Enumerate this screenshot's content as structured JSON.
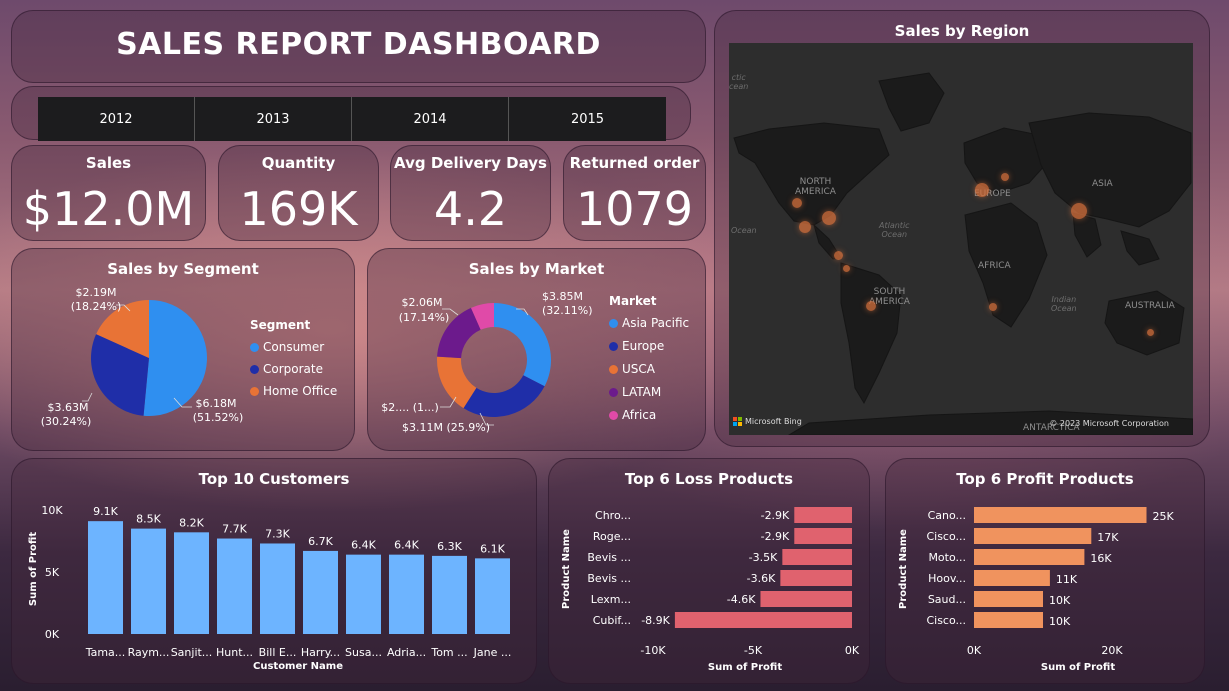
{
  "header": {
    "title": "SALES REPORT DASHBOARD"
  },
  "years": [
    "2012",
    "2013",
    "2014",
    "2015"
  ],
  "kpis": {
    "sales": {
      "label": "Sales",
      "value": "$12.0M"
    },
    "quantity": {
      "label": "Quantity",
      "value": "169K"
    },
    "delivery": {
      "label": "Avg Delivery Days",
      "value": "4.2"
    },
    "returned": {
      "label": "Returned order",
      "value": "1079"
    }
  },
  "region": {
    "title": "Sales by Region",
    "labels": {
      "north_america": "NORTH\nAMERICA",
      "europe": "EUROPE",
      "asia": "ASIA",
      "africa": "AFRICA",
      "south_america": "SOUTH\nAMERICA",
      "australia": "AUSTRALIA",
      "antarctica": "ANTARCTICA",
      "atlantic": "Atlantic\nOcean",
      "indian": "Indian\nOcean",
      "pacific": "Ocean",
      "arctic": "ctic\ncean"
    },
    "bing": "Microsoft Bing",
    "copyright": "© 2023 Microsoft Corporation"
  },
  "segment": {
    "title": "Sales by Segment",
    "legend_title": "Segment",
    "slices": [
      {
        "name": "Consumer",
        "value": 6.18,
        "label": "$6.18M",
        "pct": "(51.52%)",
        "color": "#2f8ff0"
      },
      {
        "name": "Corporate",
        "value": 3.63,
        "label": "$3.63M",
        "pct": "(30.24%)",
        "color": "#1f2ea8"
      },
      {
        "name": "Home Office",
        "value": 2.19,
        "label": "$2.19M",
        "pct": "(18.24%)",
        "color": "#e87336"
      }
    ]
  },
  "market": {
    "title": "Sales by Market",
    "legend_title": "Market",
    "slices": [
      {
        "name": "Asia Pacific",
        "value": 3.85,
        "label": "$3.85M",
        "pct": "(32.11%)",
        "color": "#2f8ff0"
      },
      {
        "name": "Europe",
        "value": 3.11,
        "label": "$3.11M (25.9%)",
        "pct": "",
        "color": "#1f2ea8"
      },
      {
        "name": "USCA",
        "value": 2.0,
        "label": "$2.... (1...)",
        "pct": "",
        "color": "#e87336"
      },
      {
        "name": "LATAM",
        "value": 2.06,
        "label": "$2.06M",
        "pct": "(17.14%)",
        "color": "#6c1a8c"
      },
      {
        "name": "Africa",
        "value": 0.78,
        "label": "",
        "pct": "",
        "color": "#e04aa8"
      }
    ]
  },
  "customers": {
    "title": "Top 10 Customers",
    "ylabel": "Sum of Profit",
    "xlabel": "Customer Name",
    "yticks": [
      "10K",
      "5K",
      "0K"
    ]
  },
  "loss": {
    "title": "Top 6 Loss Products",
    "ylabel": "Product Name",
    "xlabel": "Sum of Profit",
    "xticks": [
      "-10K",
      "-5K",
      "0K"
    ]
  },
  "profit": {
    "title": "Top 6 Profit Products",
    "ylabel": "Product Name",
    "xlabel": "Sum of Profit",
    "xticks": [
      "0K",
      "20K"
    ]
  },
  "chart_data": [
    {
      "type": "bar",
      "title": "Top 10 Customers",
      "categories": [
        "Tama...",
        "Raym...",
        "Sanjit...",
        "Hunt...",
        "Bill E...",
        "Harry...",
        "Susa...",
        "Adria...",
        "Tom ...",
        "Jane ..."
      ],
      "values": [
        9.1,
        8.5,
        8.2,
        7.7,
        7.3,
        6.7,
        6.4,
        6.4,
        6.3,
        6.1
      ],
      "labels": [
        "9.1K",
        "8.5K",
        "8.2K",
        "7.7K",
        "7.3K",
        "6.7K",
        "6.4K",
        "6.4K",
        "6.3K",
        "6.1K"
      ],
      "ylim": [
        0,
        10
      ],
      "color": "#6db4ff"
    },
    {
      "type": "bar",
      "orientation": "horizontal",
      "title": "Top 6 Loss Products",
      "categories": [
        "Chro...",
        "Roge...",
        "Bevis ...",
        "Bevis ...",
        "Lexm...",
        "Cubif..."
      ],
      "values": [
        -2.9,
        -2.9,
        -3.5,
        -3.6,
        -4.6,
        -8.9
      ],
      "labels": [
        "-2.9K",
        "-2.9K",
        "-3.5K",
        "-3.6K",
        "-4.6K",
        "-8.9K"
      ],
      "xlim": [
        -10,
        0
      ],
      "color": "#e0626e"
    },
    {
      "type": "bar",
      "orientation": "horizontal",
      "title": "Top 6 Profit Products",
      "categories": [
        "Cano...",
        "Cisco...",
        "Moto...",
        "Hoov...",
        "Saud...",
        "Cisco..."
      ],
      "values": [
        25,
        17,
        16,
        11,
        10,
        10
      ],
      "labels": [
        "25K",
        "17K",
        "16K",
        "11K",
        "10K",
        "10K"
      ],
      "xlim": [
        0,
        30
      ],
      "color": "#f0935e"
    }
  ]
}
